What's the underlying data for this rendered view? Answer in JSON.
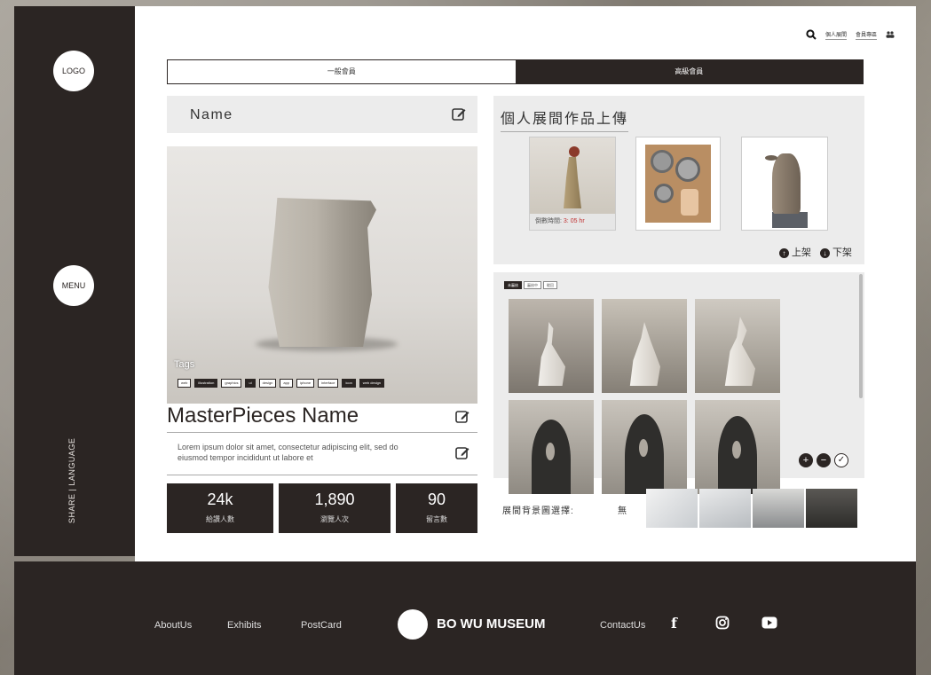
{
  "sidebar": {
    "logo_label": "LOGO",
    "menu_label": "MENU",
    "share_language": "SHARE | LANGUAGE"
  },
  "topbar": {
    "personal_exhibit": "個人展間",
    "member_center": "會員專區"
  },
  "tabs": [
    {
      "label": "一般會員",
      "active": false
    },
    {
      "label": "高級會員",
      "active": true
    }
  ],
  "profile": {
    "name": "Name",
    "tags_label": "Tags",
    "tags": [
      "web",
      "illustration",
      "graphics",
      "ui",
      "design",
      "app",
      "iphone",
      "interface",
      "icon",
      "web design"
    ],
    "dark_tags": [
      "illustration",
      "ui",
      "icon",
      "web design"
    ],
    "masterpiece_title": "MasterPieces Name",
    "description": "Lorem ipsum dolor sit amet, consectetur adipiscing elit, sed do eiusmod tempor incididunt ut labore et",
    "stats": [
      {
        "value": "24k",
        "label": "給讚人數"
      },
      {
        "value": "1,890",
        "label": "瀏覽人次"
      },
      {
        "value": "90",
        "label": "留言數"
      }
    ]
  },
  "upload": {
    "title": "個人展間作品上傳",
    "countdown_label": "倒數時間:",
    "countdown_value": "3: 05 hr",
    "publish_label": "上架",
    "unpublish_label": "下架"
  },
  "review": {
    "filters": [
      {
        "label": "未審核",
        "active": true
      },
      {
        "label": "審核中",
        "active": false
      },
      {
        "label": "駁回",
        "active": false
      }
    ]
  },
  "background_select": {
    "label": "展間背景圖選擇:",
    "none_option": "無"
  },
  "footer": {
    "about": "AboutUs",
    "exhibits": "Exhibits",
    "postcard": "PostCard",
    "brand": "BO WU MUSEUM",
    "contact": "ContactUs"
  },
  "colors": {
    "dark": "#2b2523",
    "panel": "#ececec",
    "countdown_red": "#c03030"
  }
}
